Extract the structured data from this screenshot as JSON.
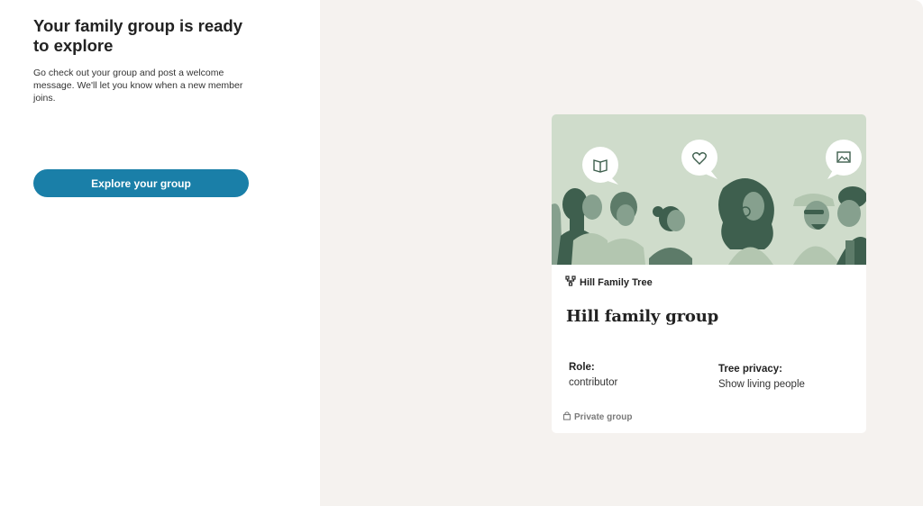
{
  "intro": {
    "headline": "Your family group is ready to explore",
    "description": "Go check out your group and post a welcome message. We'll let you know when a new member joins.",
    "explore_button_label": "Explore your group"
  },
  "group_card": {
    "tree_name": "Hill Family Tree",
    "group_title": "Hill family group",
    "role_label": "Role:",
    "role_value": "contributor",
    "privacy_label": "Tree privacy:",
    "privacy_value": "Show living people",
    "private_label": "Private group",
    "banner_icons": [
      "book-icon",
      "heart-icon",
      "image-icon"
    ]
  },
  "colors": {
    "accent": "#1a7fa8",
    "panel_background": "#f5f2ef",
    "banner_background": "#cfdccb",
    "figure_dark": "#3e5f4e",
    "figure_mid": "#86a08e",
    "figure_light": "#b3c6b0"
  }
}
